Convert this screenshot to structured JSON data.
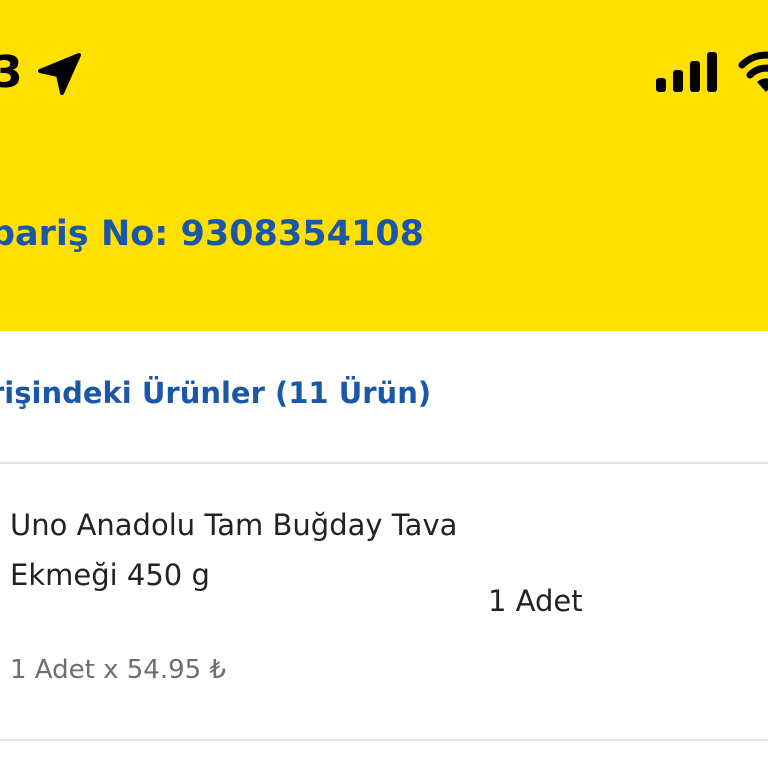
{
  "status_bar": {
    "time": "3",
    "icons": [
      "location-arrow-icon",
      "cellular-signal-icon",
      "wifi-icon"
    ]
  },
  "header": {
    "order_number": "pariş No: 9308354108",
    "background_color": "#FFE000",
    "text_color": "#1A57A6"
  },
  "section": {
    "title": "rişindeki Ürünler (11 Ürün)"
  },
  "products": [
    {
      "name": "Uno Anadolu Tam Buğday Tava Ekmeği 450 g",
      "quantity": "1 Adet",
      "price_line": "1 Adet x 54.95 ₺"
    }
  ]
}
